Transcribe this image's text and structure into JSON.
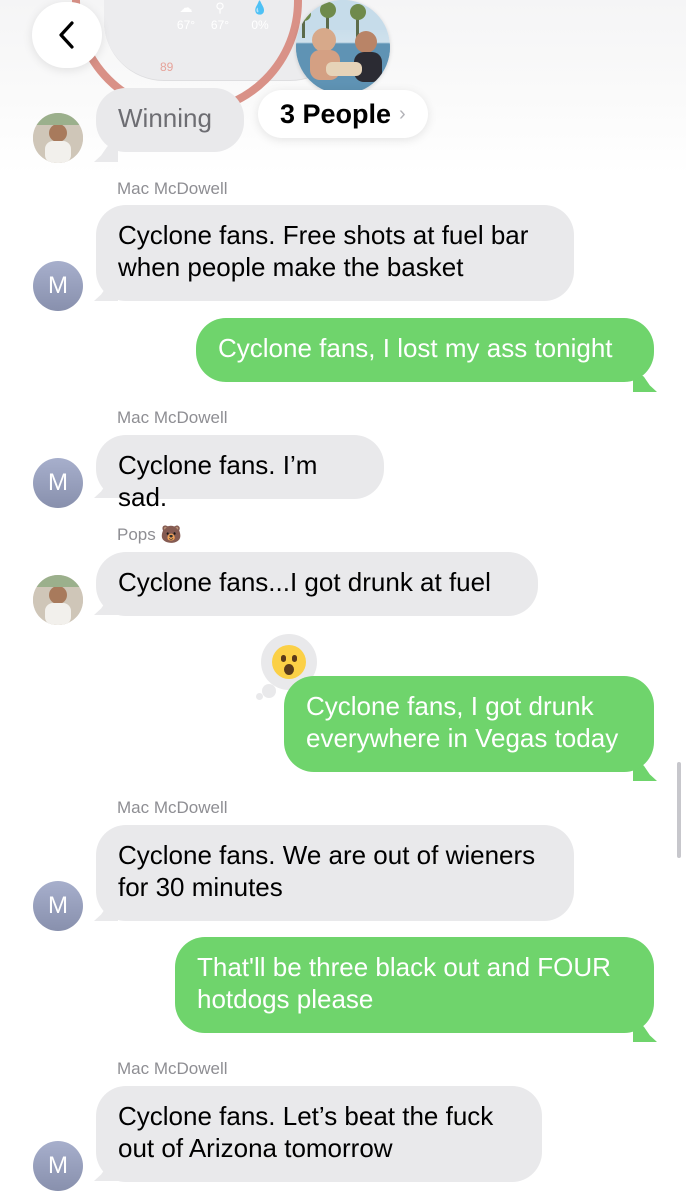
{
  "header": {
    "weather": {
      "temp_hi": "67°",
      "temp_lo": "67°",
      "precip": "0%",
      "ring_value": "89"
    },
    "group_label": "3 People",
    "group_chevron": "›"
  },
  "messages": [
    {
      "type": "in",
      "text": "Winning"
    },
    {
      "type": "in",
      "sender": "Mac McDowell",
      "avatar": "M",
      "text": "Cyclone fans. Free shots at fuel bar when people make the basket"
    },
    {
      "type": "out",
      "text": "Cyclone fans, I lost my ass tonight"
    },
    {
      "type": "in",
      "sender": "Mac McDowell",
      "avatar": "M",
      "text": "Cyclone fans. I’m sad."
    },
    {
      "type": "in",
      "sender": "Pops 🐻",
      "text": "Cyclone fans...I got drunk at fuel"
    },
    {
      "type": "out",
      "text": "Cyclone fans, I got drunk everywhere in Vegas today",
      "tapback": "surprised-face"
    },
    {
      "type": "in",
      "sender": "Mac McDowell",
      "avatar": "M",
      "text": "Cyclone fans. We are out of wieners for 30 minutes"
    },
    {
      "type": "out",
      "text": "That'll be three black out and FOUR hotdogs please"
    },
    {
      "type": "in",
      "sender": "Mac McDowell",
      "avatar": "M",
      "text": "Cyclone fans. Let’s beat the fuck out of Arizona tomorrow"
    }
  ],
  "colors": {
    "outgoing": "#6fd46c",
    "incoming": "#e9e9eb",
    "avatar_m": "#9aa1bf"
  }
}
